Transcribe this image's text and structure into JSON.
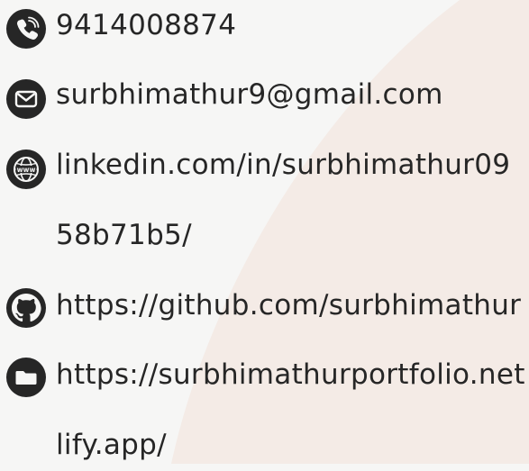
{
  "contacts": {
    "phone": "9414008874",
    "email": "surbhimathur9@gmail.com",
    "linkedin_line1": "linkedin.com/in/surbhimathur09",
    "linkedin_line2": "58b71b5/",
    "github": "https://github.com/surbhimathur",
    "portfolio_line1": "https://surbhimathurportfolio.net",
    "portfolio_line2": "lify.app/"
  },
  "icons": {
    "phone": "phone-icon",
    "email": "email-icon",
    "linkedin": "globe-icon",
    "github": "github-icon",
    "portfolio": "folder-icon"
  },
  "colors": {
    "background": "#f6f6f5",
    "accent_shape": "#f4ebe6",
    "text": "#262626",
    "icon": "#262626"
  }
}
